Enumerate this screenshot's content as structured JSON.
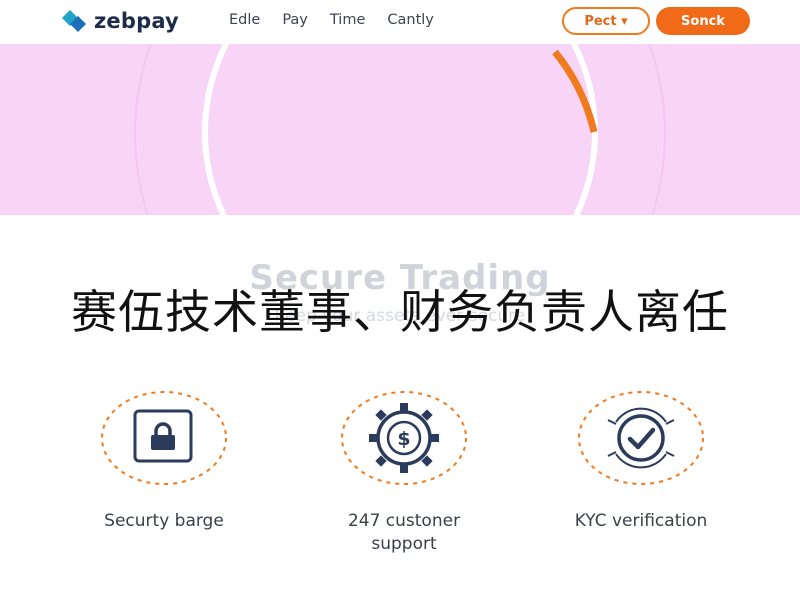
{
  "brand": {
    "name": "zebpay"
  },
  "nav": {
    "links": [
      "Edle",
      "Pay",
      "Time",
      "Cantly"
    ],
    "outline_button": "Pect ▾",
    "solid_button": "Sonck"
  },
  "hero": {
    "background": "#f8d4f7",
    "arc_color": "#f07a1d"
  },
  "section": {
    "title": "Secure Trading",
    "subtitle": "Keep your assets ever secure"
  },
  "overlay_caption": "赛伍技术董事、财务负责人离任",
  "features": [
    {
      "icon": "lock-icon",
      "label": "Securty barge"
    },
    {
      "icon": "dollar-gear-icon",
      "label_line1": "247 custoner",
      "label_line2": "support"
    },
    {
      "icon": "check-badge-icon",
      "label": "KYC verification"
    }
  ],
  "colors": {
    "accent": "#f06a18",
    "brand_dark": "#1c2b4a",
    "logo_teal": "#1fa3c9"
  }
}
